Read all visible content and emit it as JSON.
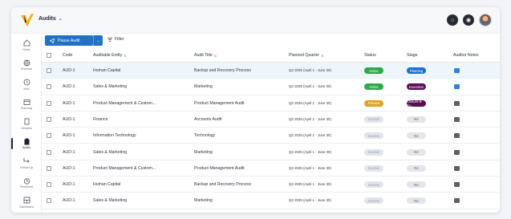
{
  "app": {
    "title": "Audits"
  },
  "sidebar": {
    "items": [
      {
        "label": "Home",
        "icon": "home-icon"
      },
      {
        "label": "Universe",
        "icon": "globe-icon"
      },
      {
        "label": "Risk",
        "icon": "clock-icon"
      },
      {
        "label": "Planning",
        "icon": "calendar-icon"
      },
      {
        "label": "Libraries",
        "icon": "book-icon"
      },
      {
        "label": "Audits",
        "icon": "clipboard-icon",
        "active": true
      },
      {
        "label": "Follow Up",
        "icon": "follow-up-icon"
      },
      {
        "label": "Timesheet",
        "icon": "timer-icon"
      },
      {
        "label": "Dashboard",
        "icon": "dashboard-icon"
      }
    ]
  },
  "toolbar": {
    "pause_label": "Pause Audit",
    "filter_label": "Filter"
  },
  "table": {
    "columns": {
      "code": "Code",
      "entity": "Auditable Entity",
      "title": "Audit Title",
      "quarter": "Planned Quarter",
      "status": "Status",
      "stage": "Stage",
      "notes": "Auditor Notes"
    },
    "rows": [
      {
        "code": "AUD-1",
        "entity": "Human Capital",
        "title": "Backup and Recovery Process",
        "quarter": "Q2 2025 (April 1 - June 30)",
        "status": "Active",
        "stage": "Planning",
        "note": "blue"
      },
      {
        "code": "AUD-1",
        "entity": "Sales & Marketing",
        "title": "Marketing",
        "quarter": "Q2 2025 (April 1 - June 30)",
        "status": "Active",
        "stage": "Execution",
        "note": "blue"
      },
      {
        "code": "AUD-1",
        "entity": "Product Management & Custom...",
        "title": "Product Management Audit",
        "quarter": "Q2 2025 (April 1 - June 30)",
        "status": "Paused",
        "stage": "Closure & Fo...",
        "note": "grey"
      },
      {
        "code": "AUD-1",
        "entity": "Finance",
        "title": "Accounts Audit",
        "quarter": "Q2 2025 (April 1 - June 30)",
        "status": "Inactive",
        "stage": "NA",
        "note": "grey"
      },
      {
        "code": "AUD-1",
        "entity": "Information Technology",
        "title": "Technology",
        "quarter": "Q2 2025 (April 1 - June 30)",
        "status": "Inactive",
        "stage": "NA",
        "note": "grey"
      },
      {
        "code": "AUD-1",
        "entity": "Sales & Marketing",
        "title": "Marketing",
        "quarter": "Q2 2025 (April 1 - June 30)",
        "status": "Inactive",
        "stage": "NA",
        "note": "grey"
      },
      {
        "code": "AUD-1",
        "entity": "Product Management & Custom...",
        "title": "Product Management Audit",
        "quarter": "Q2 2025 (April 1 - June 30)",
        "status": "Inactive",
        "stage": "NA",
        "note": "grey"
      },
      {
        "code": "AUD-1",
        "entity": "Human Capital",
        "title": "Backup and Recovery Process",
        "quarter": "Q2 2025 (April 1 - June 30)",
        "status": "Inactive",
        "stage": "NA",
        "note": "grey"
      },
      {
        "code": "AUD-1",
        "entity": "Sales & Marketing",
        "title": "Marketing",
        "quarter": "Q2 2025 (April 1 - June 30)",
        "status": "Inactive",
        "stage": "NA",
        "note": "grey"
      }
    ]
  },
  "colors": {
    "primary": "#1f72c4",
    "active": "#2ea84a",
    "paused": "#e0a31c",
    "inactive": "#e2e5ea",
    "planning": "#1f6fc9",
    "execution": "#5a0f55",
    "closure": "#5a0f55",
    "note_blue": "#2b83e0",
    "note_grey": "#5b5f66"
  }
}
